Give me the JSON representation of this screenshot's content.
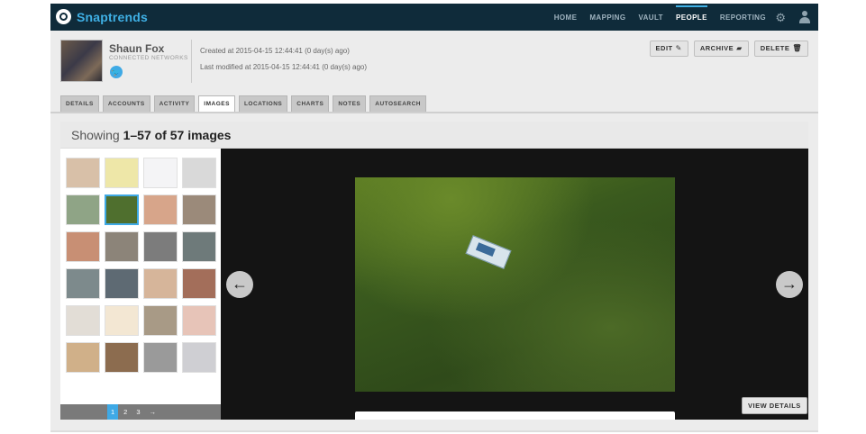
{
  "app": {
    "brand": "Snaptrends"
  },
  "nav": {
    "items": [
      "HOME",
      "MAPPING",
      "VAULT",
      "PEOPLE",
      "REPORTING"
    ],
    "active": "PEOPLE"
  },
  "icons": {
    "logo": "snaptrends-logo-icon",
    "settings": "gear-icon",
    "user": "user-icon",
    "twitter": "twitter-icon"
  },
  "profile": {
    "name": "Shaun Fox",
    "subtitle": "CONNECTED NETWORKS",
    "created": "Created at 2015-04-15 12:44:41 (0 day(s) ago)",
    "modified": "Last modified at 2015-04-15 12:44:41 (0 day(s) ago)"
  },
  "actions": {
    "edit": "EDIT",
    "archive": "ARCHIVE",
    "delete": "DELETE"
  },
  "tabs": [
    "DETAILS",
    "ACCOUNTS",
    "ACTIVITY",
    "IMAGES",
    "LOCATIONS",
    "CHARTS",
    "NOTES",
    "AUTOSEARCH"
  ],
  "active_tab": "IMAGES",
  "showing": {
    "prefix": "Showing ",
    "range": "1–57 of 57 images"
  },
  "thumbnails": [
    "#d8c0a8",
    "#eee7a8",
    "#f4f4f6",
    "#d9d9d9",
    "#8fa486",
    "#4f6f2e",
    "#d7a58a",
    "#9b8a7a",
    "#c88f74",
    "#8c8479",
    "#7c7c7c",
    "#6e7a7a",
    "#7d8a8c",
    "#5e6a73",
    "#d6b59a",
    "#a36e5a",
    "#e2ddd6",
    "#f3e7d3",
    "#a89a86",
    "#e7c4b8",
    "#d0b089",
    "#8c6c4f",
    "#9a9a9a",
    "#cfcfd3"
  ],
  "selected_thumbnail": 5,
  "pager": {
    "pages": [
      "1",
      "2",
      "3"
    ],
    "current": "1",
    "next": "→"
  },
  "viewer": {
    "prev": "←",
    "next": "→",
    "details_label": "VIEW DETAILS"
  }
}
